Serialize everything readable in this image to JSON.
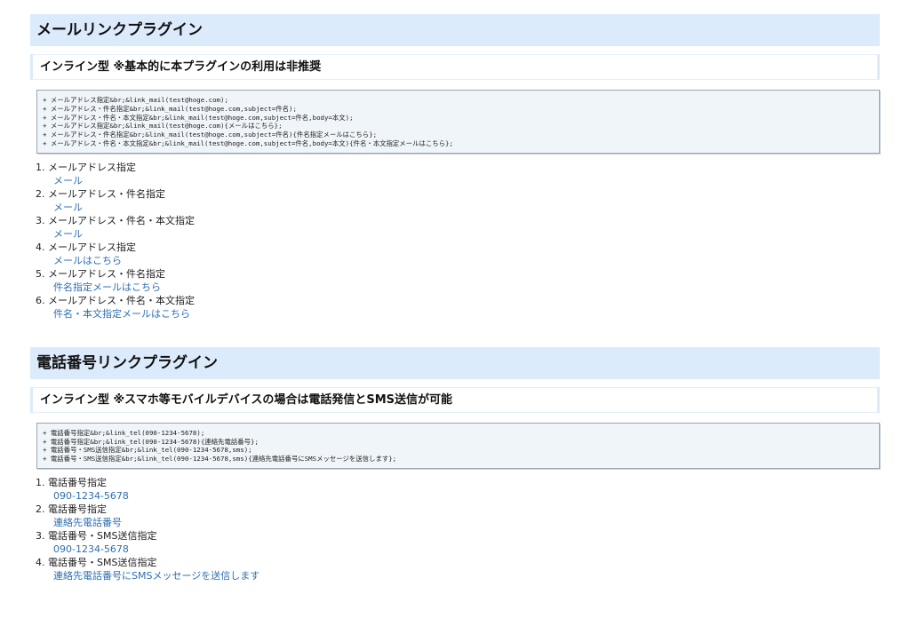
{
  "mail": {
    "heading": "メールリンクプラグイン",
    "subheading": "インライン型 ※基本的に本プラグインの利用は非推奨",
    "code_lines": [
      "+ メールアドレス指定&br;&link_mail(test@hoge.com);",
      "+ メールアドレス・件名指定&br;&link_mail(test@hoge.com,subject=件名);",
      "+ メールアドレス・件名・本文指定&br;&link_mail(test@hoge.com,subject=件名,body=本文);",
      "+ メールアドレス指定&br;&link_mail(test@hoge.com){メールはこちら};",
      "+ メールアドレス・件名指定&br;&link_mail(test@hoge.com,subject=件名){件名指定メールはこちら};",
      "+ メールアドレス・件名・本文指定&br;&link_mail(test@hoge.com,subject=件名,body=本文){件名・本文指定メールはこちら};"
    ],
    "items": [
      {
        "num": "1.",
        "label": "メールアドレス指定",
        "link": "メール"
      },
      {
        "num": "2.",
        "label": "メールアドレス・件名指定",
        "link": "メール"
      },
      {
        "num": "3.",
        "label": "メールアドレス・件名・本文指定",
        "link": "メール"
      },
      {
        "num": "4.",
        "label": "メールアドレス指定",
        "link": "メールはこちら"
      },
      {
        "num": "5.",
        "label": "メールアドレス・件名指定",
        "link": "件名指定メールはこちら"
      },
      {
        "num": "6.",
        "label": "メールアドレス・件名・本文指定",
        "link": "件名・本文指定メールはこちら"
      }
    ]
  },
  "tel": {
    "heading": "電話番号リンクプラグイン",
    "subheading": "インライン型 ※スマホ等モバイルデバイスの場合は電話発信とSMS送信が可能",
    "code_lines": [
      "+ 電話番号指定&br;&link_tel(090-1234-5678);",
      "+ 電話番号指定&br;&link_tel(090-1234-5678){連絡先電話番号};",
      "+ 電話番号・SMS送信指定&br;&link_tel(090-1234-5678,sms);",
      "+ 電話番号・SMS送信指定&br;&link_tel(090-1234-5678,sms){連絡先電話番号にSMSメッセージを送信します};"
    ],
    "items": [
      {
        "num": "1.",
        "label": "電話番号指定",
        "link": "090-1234-5678"
      },
      {
        "num": "2.",
        "label": "電話番号指定",
        "link": "連絡先電話番号"
      },
      {
        "num": "3.",
        "label": "電話番号・SMS送信指定",
        "link": "090-1234-5678"
      },
      {
        "num": "4.",
        "label": "電話番号・SMS送信指定",
        "link": "連絡先電話番号にSMSメッセージを送信します"
      }
    ]
  },
  "colors": {
    "heading_bg": "#dcebfb",
    "link": "#2f6fb0",
    "code_bg": "#f0f5fa"
  }
}
